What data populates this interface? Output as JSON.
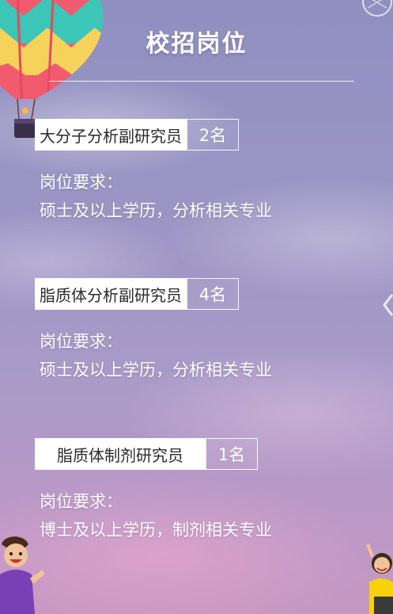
{
  "header": {
    "title": "校招岗位"
  },
  "positions": [
    {
      "name": "大分子分析副研究员",
      "count": "2名",
      "requirement_label": "岗位要求：",
      "requirement": "硕士及以上学历，分析相关专业"
    },
    {
      "name": "脂质体分析副研究员",
      "count": "4名",
      "requirement_label": "岗位要求：",
      "requirement": "硕士及以上学历，分析相关专业"
    },
    {
      "name": "脂质体制剂研究员",
      "count": "1名",
      "requirement_label": "岗位要求：",
      "requirement": "博士及以上学历，制剂相关专业"
    }
  ],
  "decorations": {
    "balloon": "hot-air-balloon-icon",
    "left_character": "cartoon-boy-icon",
    "right_character": "cartoon-girl-icon",
    "side_arrow": "chevron-left-icon"
  },
  "colors": {
    "text": "#ffffff",
    "tag_background": "#ffffff",
    "tag_text": "#2a2a2a"
  }
}
